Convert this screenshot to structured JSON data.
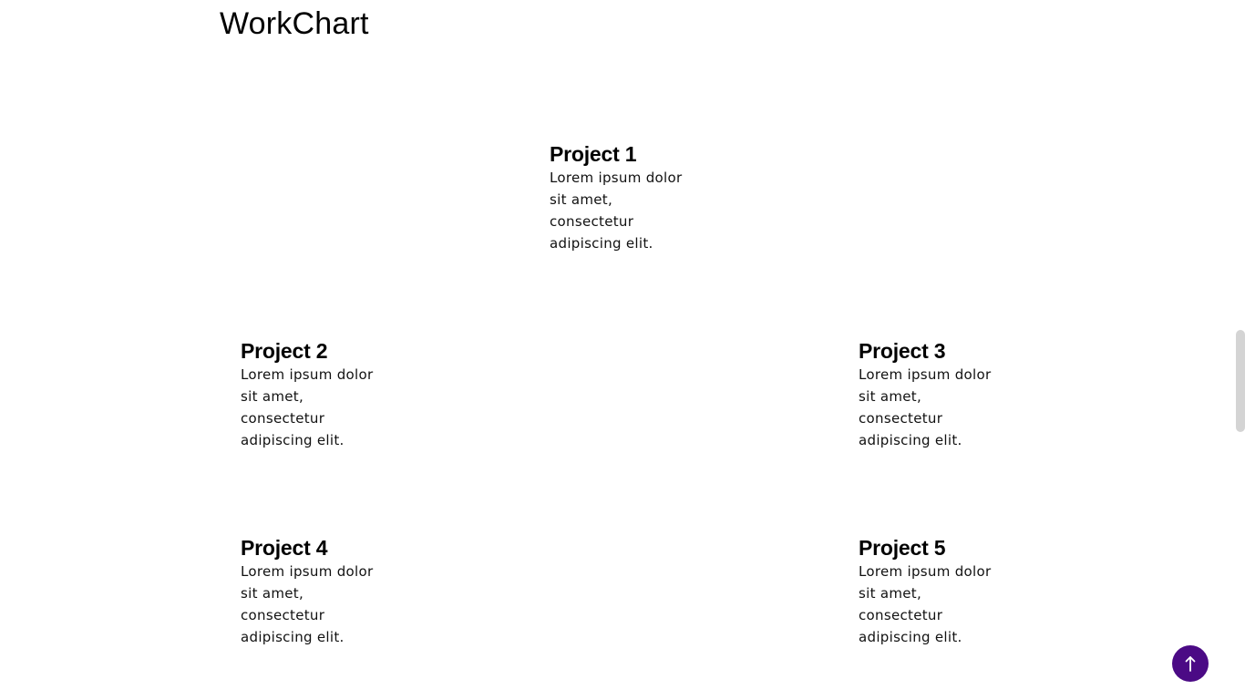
{
  "header": {
    "brand": "WorkChart"
  },
  "projects": [
    {
      "title": "Project 1",
      "description": "Lorem ipsum dolor sit amet, consectetur adipiscing elit."
    },
    {
      "title": "Project 2",
      "description": "Lorem ipsum dolor sit amet, consectetur adipiscing elit."
    },
    {
      "title": "Project 3",
      "description": "Lorem ipsum dolor sit amet, consectetur adipiscing elit."
    },
    {
      "title": "Project 4",
      "description": "Lorem ipsum dolor sit amet, consectetur adipiscing elit."
    },
    {
      "title": "Project 5",
      "description": "Lorem ipsum dolor sit amet, consectetur adipiscing elit."
    }
  ],
  "back_to_top": {
    "icon": "arrow-up-icon",
    "color": "#4b0a85"
  },
  "colors": {
    "background": "#ffffff",
    "text": "#000000",
    "accent": "#4b0a85"
  }
}
